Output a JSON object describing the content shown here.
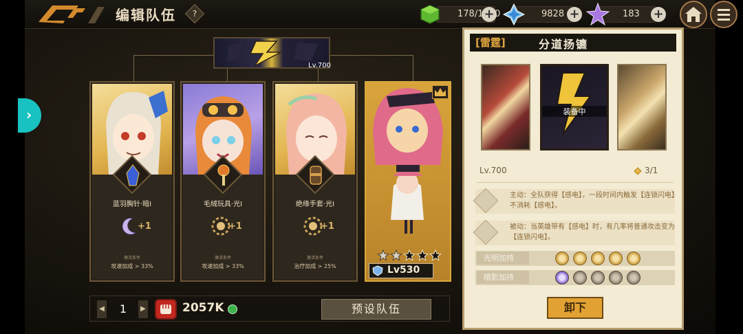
{
  "header": {
    "title": "编辑队伍",
    "help_icon": "?",
    "resources": [
      {
        "name": "stamina",
        "icon": "green-cube-icon",
        "value": "178/1800"
      },
      {
        "name": "crystal",
        "icon": "blue-crystal-icon",
        "value": "9828"
      },
      {
        "name": "star-gem",
        "icon": "purple-star-icon",
        "value": "183"
      }
    ],
    "plus": "+"
  },
  "side_arrow": "›",
  "team_banner": {
    "level": "Lv.700"
  },
  "heroes": [
    {
      "gear_name": "蓝羽胸针·暗I",
      "bonus": "+1",
      "bonus_icon": "moon-icon",
      "cond_title": "激活条件",
      "cond_text": "攻速加成 > 33%"
    },
    {
      "gear_name": "毛绒玩具·光I",
      "bonus": "+1",
      "bonus_icon": "sun-icon",
      "cond_title": "激活条件",
      "cond_text": "攻速加成 > 33%"
    },
    {
      "gear_name": "绝缘手套·光I",
      "bonus": "+1",
      "bonus_icon": "sun-icon",
      "cond_title": "激活条件",
      "cond_text": "治疗加成 > 25%"
    }
  ],
  "leader": {
    "level": "Lv530",
    "stars_filled": 3,
    "stars_empty": 2
  },
  "bottom": {
    "team_index": "1",
    "prev": "◀",
    "next": "▶",
    "power": "2057K",
    "preset_label": "预设队伍"
  },
  "panel": {
    "tag": "[雷霆]",
    "title": "分道扬镳",
    "equipped_label": "装备中",
    "level": "Lv.700",
    "count": "3/1",
    "skills": [
      {
        "icon": "active-skill-icon",
        "text": "主动：全队获得【感电】，一段时间内触发【连锁闪电】不消耗【感电】。"
      },
      {
        "icon": "passive-skill-icon",
        "text": "被动：当英雄带有【感电】时，有几率将普通攻击变为【连锁闪电】。"
      }
    ],
    "light_label": "光明加持",
    "dark_label": "暗影加持",
    "light_filled": 5,
    "dark_filled": 1,
    "unequip_label": "卸下"
  },
  "colors": {
    "accent": "#e2a233",
    "panel_bg": "#f3ebd3",
    "teal": "#18c2c0",
    "power_red": "#c2281f"
  }
}
